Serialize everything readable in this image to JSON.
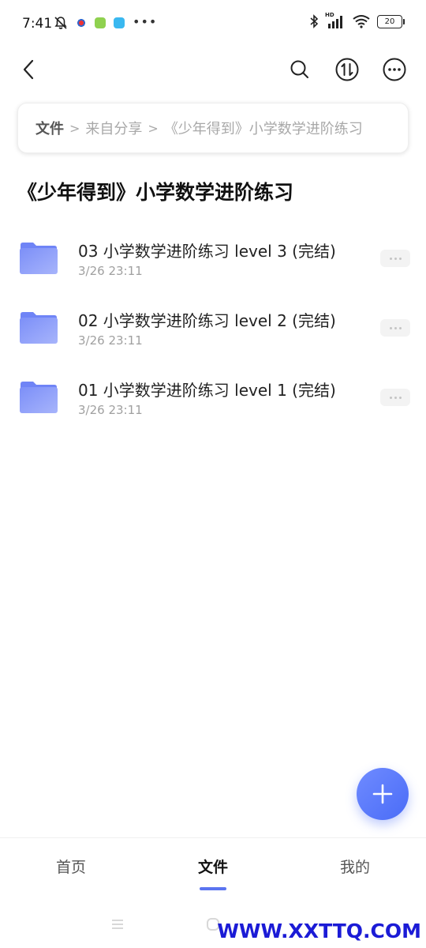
{
  "status_bar": {
    "time": "7:41",
    "battery": "20",
    "network_label": "HD"
  },
  "breadcrumb": {
    "items": [
      "文件",
      "来自分享",
      "《少年得到》小学数学进阶练习"
    ],
    "separator": ">"
  },
  "page": {
    "title": "《少年得到》小学数学进阶练习"
  },
  "files": [
    {
      "name": "03 小学数学进阶练习 level 3 (完结)",
      "date": "3/26 23:11"
    },
    {
      "name": "02 小学数学进阶练习 level 2 (完结)",
      "date": "3/26 23:11"
    },
    {
      "name": "01 小学数学进阶练习 level 1 (完结)",
      "date": "3/26 23:11"
    }
  ],
  "bottom_nav": {
    "items": [
      {
        "label": "首页"
      },
      {
        "label": "文件"
      },
      {
        "label": "我的"
      }
    ],
    "active_index": 1
  },
  "watermark": "WWW.XXTTQ.COM",
  "colors": {
    "accent": "#5b74f0",
    "folder": "#7b8ff5",
    "fab": "#4a6cf7",
    "watermark": "#1b1bd6"
  },
  "icons": {
    "back": "chevron-left-icon",
    "search": "search-icon",
    "sort": "sort-icon",
    "more": "more-icon",
    "folder": "folder-icon",
    "add": "plus-icon"
  }
}
